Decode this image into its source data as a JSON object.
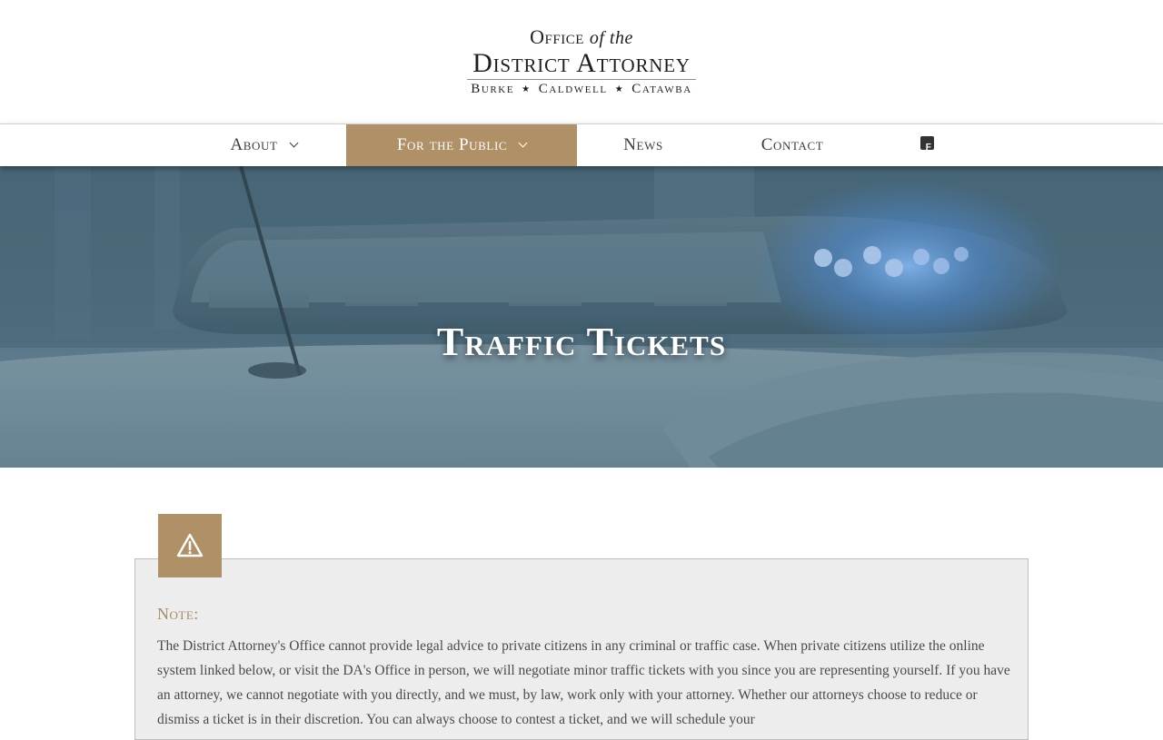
{
  "logo": {
    "line1_office": "Office",
    "line1_ofthe": "of the",
    "line2": "District Attorney",
    "county1": "Burke",
    "county2": "Caldwell",
    "county3": "Catawba",
    "separator": "★"
  },
  "nav": {
    "items": [
      {
        "label": "About",
        "has_dropdown": true,
        "active": false
      },
      {
        "label": "For the Public",
        "has_dropdown": true,
        "active": true
      },
      {
        "label": "News",
        "has_dropdown": false,
        "active": false
      },
      {
        "label": "Contact",
        "has_dropdown": false,
        "active": false
      }
    ],
    "social_icon": "facebook-icon",
    "facebook_glyph": "f",
    "active_color": "#b09066"
  },
  "hero": {
    "title": "Traffic Tickets",
    "background": "police-car-lightbar-photo"
  },
  "note": {
    "icon": "warning-icon",
    "label": "Note:",
    "text": "The District Attorney's Office cannot provide legal advice to private citizens in any criminal or traffic case. When private citizens utilize the online system linked below, or visit the DA's Office in person, we will negotiate minor traffic tickets with you since you are representing yourself. If you have an attorney, we cannot negotiate with you directly, and we must, by law, work only with your attorney. Whether our attorneys choose to reduce or dismiss a ticket is in their discretion. You can always choose to contest a ticket, and we will schedule your",
    "accent_color": "#b09066"
  }
}
